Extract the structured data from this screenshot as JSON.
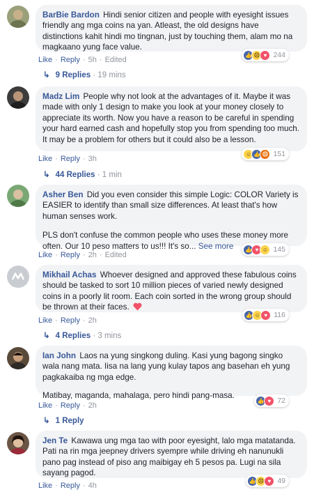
{
  "comments": [
    {
      "author": "BarBie Bardon",
      "text": "Hindi senior citizen and people with eyesight issues friendly ang mga coins na yan. Atleast, the old designs have distinctions kahit hindi mo tingnan, just by touching them, alam mo na magkaano yung face value.",
      "actions": {
        "like": "Like",
        "reply": "Reply",
        "time": "5h",
        "edited": "Edited"
      },
      "reaction_count": "244",
      "reaction_icons": [
        "like-icon",
        "sad-icon",
        "love-icon"
      ],
      "replies_label": "9 Replies",
      "replies_time": "19 mins"
    },
    {
      "author": "Madz Lim",
      "text": "People why not look at the advantages of it. Maybe it was made with only 1 design to make you look at your money closely to appreciate its worth. Now you have a reason to be careful in spending your hard earned cash and hopefully stop you from spending too much. It may be a problem for others but it could also be a lesson.",
      "actions": {
        "like": "Like",
        "reply": "Reply",
        "time": "3h"
      },
      "reaction_count": "151",
      "reaction_icons": [
        "haha-icon",
        "like-icon",
        "angry-icon"
      ],
      "replies_label": "44 Replies",
      "replies_time": "1 min"
    },
    {
      "author": "Asher Ben",
      "text": "Did you even consider this simple Logic: COLOR Variety is EASIER to identify than small size differences. At least that's how human senses work.",
      "text2": "PLS don't confuse the common people who uses these money more often. Our 10 peso matters to us!!! It's so...",
      "see_more": "See more",
      "actions": {
        "like": "Like",
        "reply": "Reply",
        "time": "2h",
        "edited": "Edited"
      },
      "reaction_count": "145",
      "reaction_icons": [
        "like-icon",
        "love-icon",
        "haha-icon"
      ]
    },
    {
      "author": "Mikhail Achas",
      "text": "Whoever designed and approved these fabulous coins should be tasked to sort 10 million pieces of varied newly designed coins in a poorly lit room. Each coin sorted in the wrong group should be thrown at their faces.",
      "actions": {
        "like": "Like",
        "reply": "Reply",
        "time": "2h"
      },
      "reaction_count": "116",
      "reaction_icons": [
        "like-icon",
        "haha-icon",
        "love-icon"
      ],
      "replies_label": "4 Replies",
      "replies_time": "3 mins"
    },
    {
      "author": "Ian John",
      "text": "Laos na yung singkong duling. Kasi yung bagong singko wala nang mata. Iisa na lang yung kulay tapos ang basehan eh yung pagkakaiba ng mga edge.",
      "text2": "Matibay, maganda, mahalaga, pero hindi pang-masa.",
      "actions": {
        "like": "Like",
        "reply": "Reply",
        "time": "2h"
      },
      "reaction_count": "72",
      "reaction_icons": [
        "like-icon",
        "love-icon"
      ],
      "replies_label": "1 Reply"
    },
    {
      "author": "Jen Te",
      "text": "Kawawa ung mga tao with poor eyesight, lalo mga matatanda. Pati na rin mga jeepney drivers syempre while driving eh nanunukli pano pag instead of piso ang maibigay eh 5 pesos pa. Lugi na sila sayang pagod.",
      "actions": {
        "like": "Like",
        "reply": "Reply",
        "time": "4h"
      },
      "reaction_count": "49",
      "reaction_icons": [
        "like-icon",
        "sad-icon",
        "love-icon"
      ]
    }
  ],
  "colors": {
    "link": "#385898",
    "meta": "#90949c",
    "bubble": "#f2f3f5",
    "like": "#4867aa",
    "love": "#f25268"
  }
}
